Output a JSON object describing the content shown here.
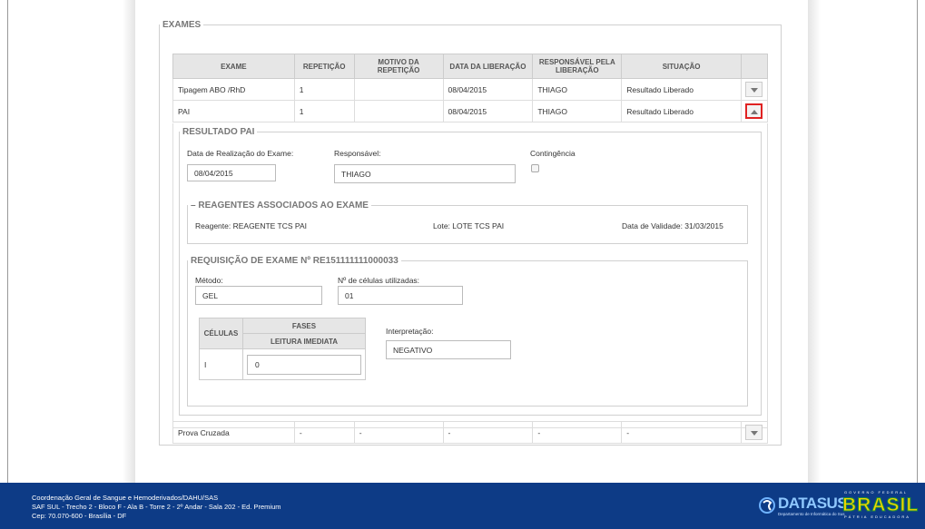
{
  "exames": {
    "legend": "EXAMES",
    "columns": [
      "EXAME",
      "REPETIÇÃO",
      "MOTIVO DA REPETIÇÃO",
      "DATA DA LIBERAÇÃO",
      "RESPONSÁVEL PELA LIBERAÇÃO",
      "SITUAÇÃO"
    ],
    "rows": [
      {
        "exame": "Tipagem ABO /RhD",
        "repeticao": "1",
        "motivo": "",
        "data": "08/04/2015",
        "responsavel": "THIAGO",
        "situacao": "Resultado Liberado"
      },
      {
        "exame": "PAI",
        "repeticao": "1",
        "motivo": "",
        "data": "08/04/2015",
        "responsavel": "THIAGO",
        "situacao": "Resultado Liberado"
      },
      {
        "exame": "Prova Cruzada",
        "repeticao": "-",
        "motivo": "-",
        "data": "-",
        "responsavel": "-",
        "situacao": "-"
      }
    ]
  },
  "resultado": {
    "legend": "RESULTADO PAI",
    "data_realizacao_label": "Data de Realização do Exame:",
    "data_realizacao_value": "08/04/2015",
    "responsavel_label": "Responsável:",
    "responsavel_value": "THIAGO",
    "contingencia_label": "Contingência"
  },
  "reagentes": {
    "legend": "REAGENTES ASSOCIADOS AO EXAME",
    "reagente": "Reagente: REAGENTE TCS PAI",
    "lote": "Lote: LOTE TCS PAI",
    "validade": "Data de Validade: 31/03/2015"
  },
  "requisicao": {
    "legend": "REQUISIÇÃO DE EXAME Nº RE151111111000033",
    "metodo_label": "Método:",
    "metodo_value": "GEL",
    "celulas_label": "Nº de células utilizadas:",
    "celulas_value": "01",
    "interpretacao_label": "Interpretação:",
    "interpretacao_value": "NEGATIVO",
    "table": {
      "col_celulas": "CÉLULAS",
      "col_fases": "FASES",
      "col_leitura": "LEITURA IMEDIATA",
      "row_celula": "I",
      "row_leitura": "0"
    }
  },
  "footer": {
    "line1": "Coordenação Geral de Sangue e Hemoderivados/DAHU/SAS",
    "line2": "SAF SUL - Trecho 2 - Bloco F - Ala B - Torre 2 - 2º Andar - Sala 202 - Ed. Premium",
    "line3": "Cep: 70.070-600 - Brasília - DF",
    "datasus": "DATASUS",
    "datasus_sub": "Departamento de Informática do Sus",
    "brasil": "BRASIL",
    "governo": "GOVERNO FEDERAL",
    "patria": "PÁTRIA EDUCADORA"
  },
  "colors": {
    "footer_bg": "#0d3b86",
    "highlight": "#e02222",
    "brasil_yellow": "#f4d400",
    "brasil_green": "#1a8c3c"
  }
}
